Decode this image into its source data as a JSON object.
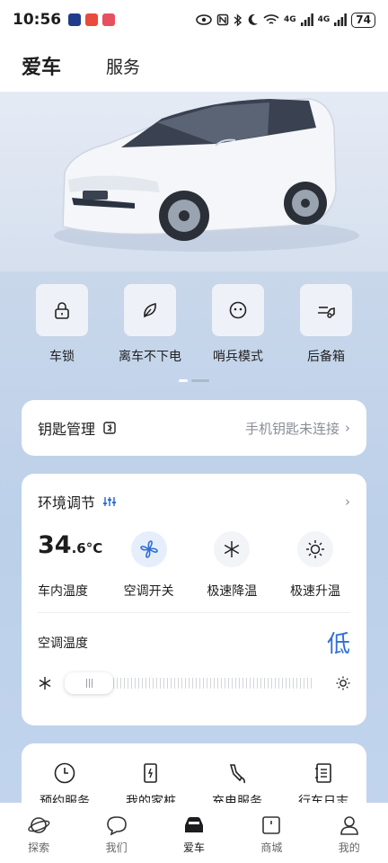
{
  "status_bar": {
    "time": "10:56",
    "battery": "74",
    "network_1": "4G",
    "network_2": "4G"
  },
  "header": {
    "tabs": [
      {
        "label": "爱车",
        "active": true
      },
      {
        "label": "服务",
        "active": false
      }
    ]
  },
  "quick_actions": [
    {
      "label": "车锁",
      "icon": "lock-icon"
    },
    {
      "label": "离车不下电",
      "icon": "leaf-icon"
    },
    {
      "label": "哨兵模式",
      "icon": "sentry-face-icon"
    },
    {
      "label": "后备箱",
      "icon": "car-trunk-icon"
    }
  ],
  "key_card": {
    "title": "钥匙管理",
    "status": "手机钥匙未连接",
    "chevron": "›"
  },
  "environment": {
    "title": "环境调节",
    "chevron": "›",
    "cabin_temp_int": "34",
    "cabin_temp_dec": ".6",
    "cabin_temp_unit": "°C",
    "cabin_temp_label": "车内温度",
    "controls": [
      {
        "label": "空调开关",
        "icon": "fan-icon",
        "active": true
      },
      {
        "label": "极速降温",
        "icon": "snowflake-icon",
        "active": false
      },
      {
        "label": "极速升温",
        "icon": "sun-icon",
        "active": false
      }
    ],
    "ac_temp_label": "空调温度",
    "ac_temp_level": "低",
    "slider_value": 0
  },
  "services": [
    {
      "label": "预约服务",
      "icon": "clock-icon"
    },
    {
      "label": "我的家桩",
      "icon": "charging-pile-icon"
    },
    {
      "label": "充电服务",
      "icon": "charging-gun-icon"
    },
    {
      "label": "行车日志",
      "icon": "logbook-icon"
    }
  ],
  "tabbar": [
    {
      "label": "探索",
      "icon": "planet-icon",
      "active": false
    },
    {
      "label": "我们",
      "icon": "chat-bubble-icon",
      "active": false
    },
    {
      "label": "爱车",
      "icon": "car-icon",
      "active": true
    },
    {
      "label": "商城",
      "icon": "store-icon",
      "active": false
    },
    {
      "label": "我的",
      "icon": "person-icon",
      "active": false
    }
  ],
  "colors": {
    "accent": "#2f6fd6",
    "muted_text": "#8a8e96",
    "card_bg": "#ffffff"
  }
}
